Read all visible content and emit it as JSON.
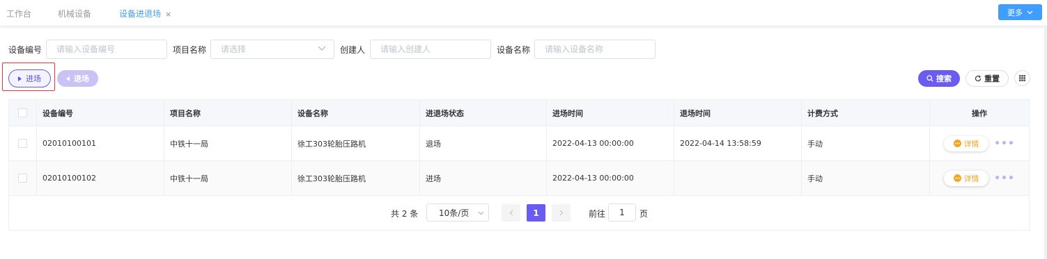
{
  "tabs": [
    {
      "label": "工作台"
    },
    {
      "label": "机械设备"
    },
    {
      "label": "设备进退场",
      "close": "×"
    }
  ],
  "more_button": {
    "label": "更多"
  },
  "filters": {
    "device_no": {
      "label": "设备编号",
      "placeholder": "请输入设备编号"
    },
    "project": {
      "label": "项目名称",
      "placeholder": "请选择"
    },
    "creator": {
      "label": "创建人",
      "placeholder": "请输入创建人"
    },
    "device_name": {
      "label": "设备名称",
      "placeholder": "请输入设备名称"
    }
  },
  "actions": {
    "enter": "进场",
    "exit": "退场",
    "search": "搜索",
    "reset": "重置"
  },
  "table": {
    "headers": [
      "设备编号",
      "项目名称",
      "设备名称",
      "进退场状态",
      "进场时间",
      "退场时间",
      "计费方式",
      "操作"
    ],
    "rows": [
      [
        "02010100101",
        "中铁十一局",
        "徐工303轮胎压路机",
        "退场",
        "2022-04-13 00:00:00",
        "2022-04-14 13:58:59",
        "手动"
      ],
      [
        "02010100102",
        "中铁十一局",
        "徐工303轮胎压路机",
        "进场",
        "2022-04-13 00:00:00",
        "",
        "手动"
      ]
    ],
    "detail_label": "详情",
    "more_dots": "•••"
  },
  "pagination": {
    "total": "共 2 条",
    "page_size": "10条/页",
    "current_page": "1",
    "goto_label": "前往",
    "goto_value": "1",
    "page_unit": "页"
  },
  "colors": {
    "primary": "#6a5cf0",
    "blue": "#409eff",
    "warning": "#f5a623",
    "highlight": "#e53935"
  }
}
